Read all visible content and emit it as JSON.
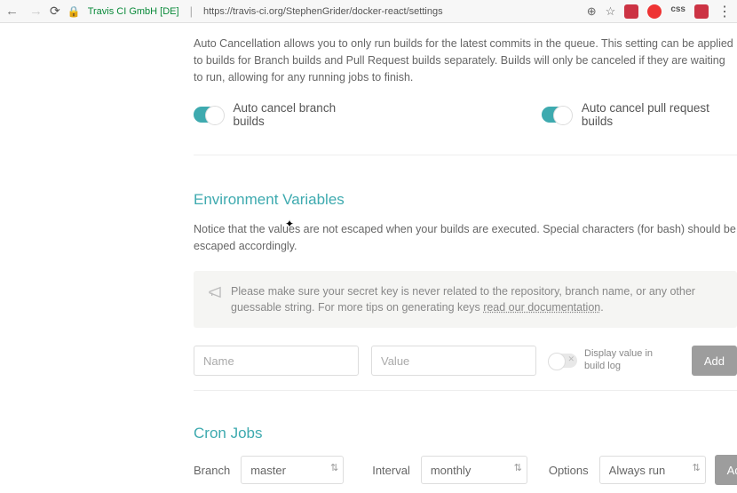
{
  "browser": {
    "org": "Travis CI GmbH [DE]",
    "url": "https://travis-ci.org/StephenGrider/docker-react/settings"
  },
  "autoCancel": {
    "desc": "Auto Cancellation allows you to only run builds for the latest commits in the queue. This setting can be applied to builds for Branch builds and Pull Request builds separately. Builds will only be canceled if they are waiting to run, allowing for any running jobs to finish.",
    "branchLabel": "Auto cancel branch builds",
    "prLabel": "Auto cancel pull request builds"
  },
  "envVars": {
    "heading": "Environment Variables",
    "notice": "Notice that the values are not escaped when your builds are executed. Special characters (for bash) should be escaped accordingly.",
    "tipPrefix": "Please make sure your secret key is never related to the repository, branch name, or any other guessable string. For more tips on generating keys ",
    "tipLink": "read our documentation",
    "namePlaceholder": "Name",
    "valuePlaceholder": "Value",
    "displayToggleLabel": "Display value in build log",
    "addLabel": "Add"
  },
  "cron": {
    "heading": "Cron Jobs",
    "branchLabel": "Branch",
    "branchValue": "master",
    "intervalLabel": "Interval",
    "intervalValue": "monthly",
    "optionsLabel": "Options",
    "optionsValue": "Always run",
    "addLabel": "Add"
  }
}
